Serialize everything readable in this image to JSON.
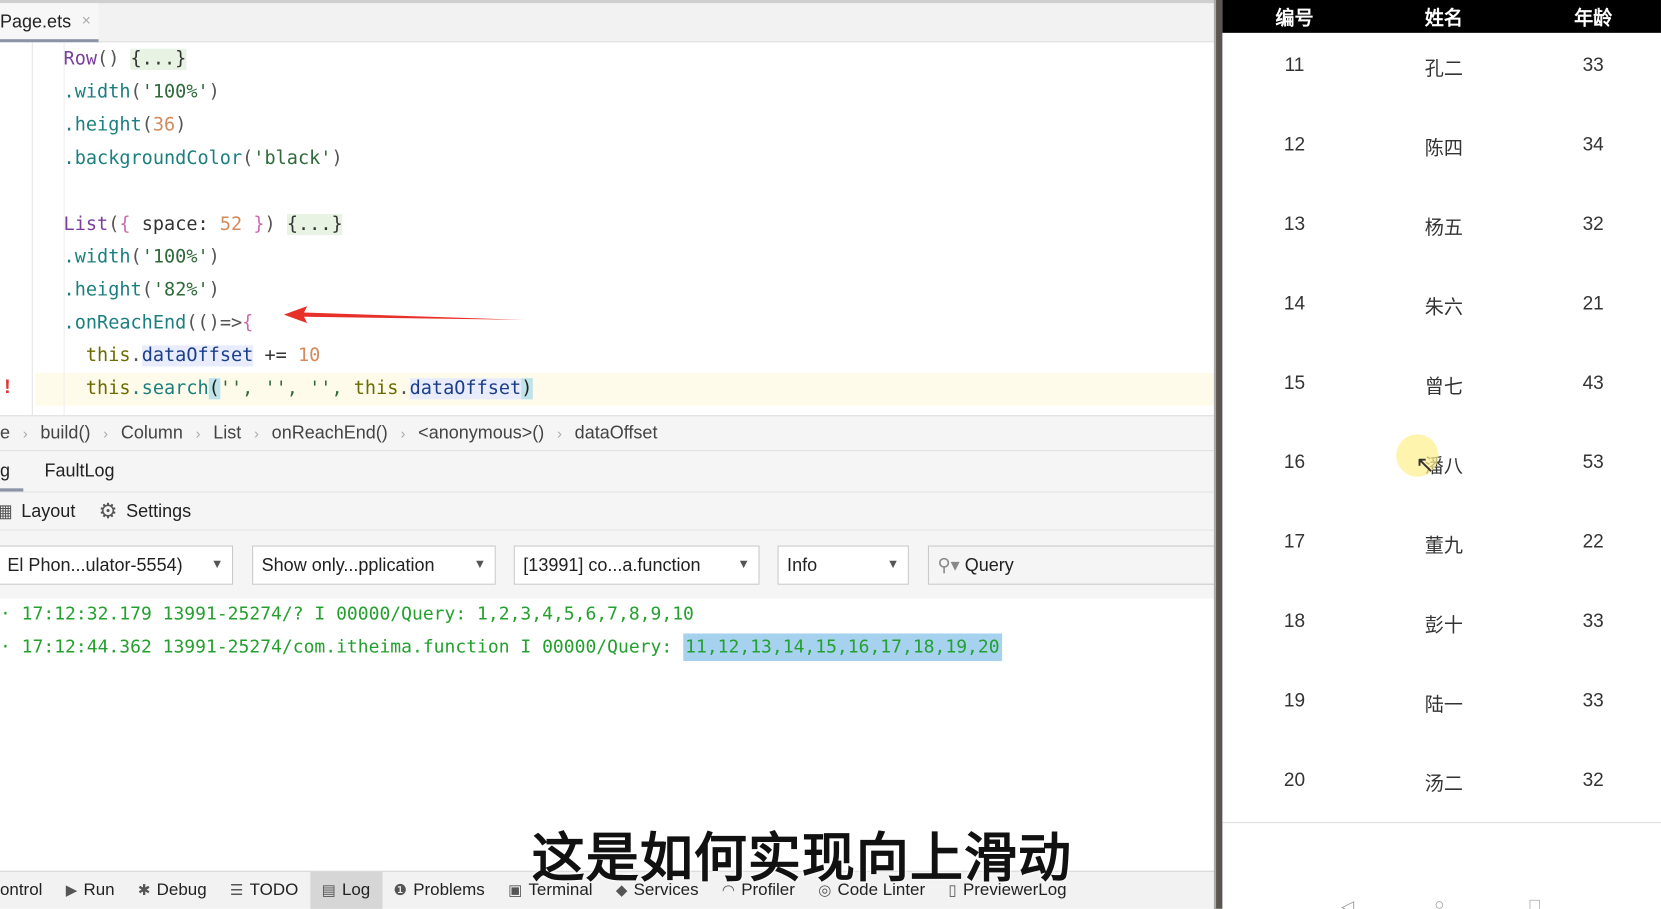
{
  "editor": {
    "tab": {
      "name": "Page.ets",
      "close": "×"
    },
    "code": [
      [
        [
          "Row",
          "k-fn"
        ],
        [
          "() ",
          "k-p"
        ],
        [
          "{...}",
          "k-fold"
        ]
      ],
      [
        [
          ".width",
          "k-m"
        ],
        [
          "(",
          "k-p"
        ],
        [
          "'100%'",
          "k-s"
        ],
        [
          ")",
          "k-p"
        ]
      ],
      [
        [
          ".height",
          "k-m"
        ],
        [
          "(",
          "k-p"
        ],
        [
          "36",
          "k-n"
        ],
        [
          ")",
          "k-p"
        ]
      ],
      [
        [
          ".backgroundColor",
          "k-m"
        ],
        [
          "(",
          "k-p"
        ],
        [
          "'black'",
          "k-s"
        ],
        [
          ")",
          "k-p"
        ]
      ],
      [],
      [
        [
          "List",
          "k-fn"
        ],
        [
          "(",
          "k-p"
        ],
        [
          "{",
          "k-pk"
        ],
        [
          " space: ",
          "k-txt"
        ],
        [
          "52",
          "k-n"
        ],
        [
          " }",
          "k-pk"
        ],
        [
          ") ",
          "k-p"
        ],
        [
          "{...}",
          "k-fold"
        ]
      ],
      [
        [
          ".width",
          "k-m"
        ],
        [
          "(",
          "k-p"
        ],
        [
          "'100%'",
          "k-s"
        ],
        [
          ")",
          "k-p"
        ]
      ],
      [
        [
          ".height",
          "k-m"
        ],
        [
          "(",
          "k-p"
        ],
        [
          "'82%'",
          "k-s"
        ],
        [
          ")",
          "k-p"
        ]
      ],
      [
        [
          ".onReachEnd",
          "k-m"
        ],
        [
          "(()=>",
          "k-p"
        ],
        [
          "{",
          "k-pk"
        ]
      ],
      [
        [
          "  this",
          "k-this"
        ],
        [
          ".",
          "k-p"
        ],
        [
          "dataOffset",
          "k-f"
        ],
        [
          " += ",
          "k-txt"
        ],
        [
          "10",
          "k-n"
        ]
      ],
      [
        [
          "  this",
          "k-this"
        ],
        [
          ".search",
          "k-m"
        ],
        [
          "(",
          "k-br"
        ],
        [
          "'', '', '', ",
          "k-s"
        ],
        [
          "this",
          "k-this"
        ],
        [
          ".",
          "k-p"
        ],
        [
          "dataOffset",
          "k-f"
        ],
        [
          ")",
          "k-br"
        ]
      ]
    ],
    "breadcrumb": [
      "e",
      "build()",
      "Column",
      "List",
      "onReachEnd()",
      "<anonymous>()",
      "dataOffset"
    ]
  },
  "log": {
    "tabs": [
      "g",
      "FaultLog"
    ],
    "tools": {
      "layout": "Layout",
      "settings": "Settings"
    },
    "filters": {
      "device": "El Phon...ulator-5554)",
      "scope": "Show only...pplication",
      "process": "[13991] co...a.function",
      "level": "Info",
      "query_placeholder": "Query"
    },
    "lines": [
      {
        "prefix": "· 17:12:32.179 13991-25274/? I 00000/Query: ",
        "data": "1,2,3,4,5,6,7,8,9,10"
      },
      {
        "prefix": "· 17:12:44.362 13991-25274/com.itheima.function I 00000/Query: ",
        "data": "11,12,13,14,15,16,17,18,19,20"
      }
    ]
  },
  "bottom_tools": [
    {
      "label": "ontrol",
      "icon": ""
    },
    {
      "label": "Run",
      "icon": "▶"
    },
    {
      "label": "Debug",
      "icon": "✱"
    },
    {
      "label": "TODO",
      "icon": "☰"
    },
    {
      "label": "Log",
      "icon": "▤"
    },
    {
      "label": "Problems",
      "icon": "❶"
    },
    {
      "label": "Terminal",
      "icon": "▣"
    },
    {
      "label": "Services",
      "icon": "◆"
    },
    {
      "label": "Profiler",
      "icon": "◠"
    },
    {
      "label": "Code Linter",
      "icon": "◎"
    },
    {
      "label": "PreviewerLog",
      "icon": "▯"
    }
  ],
  "subtitle": "这是如何实现向上滑动",
  "phone": {
    "headers": [
      "编号",
      "姓名",
      "年龄"
    ],
    "rows": [
      [
        "11",
        "孔二",
        "33"
      ],
      [
        "12",
        "陈四",
        "34"
      ],
      [
        "13",
        "杨五",
        "32"
      ],
      [
        "14",
        "朱六",
        "21"
      ],
      [
        "15",
        "曾七",
        "43"
      ],
      [
        "16",
        "潘八",
        "53"
      ],
      [
        "17",
        "董九",
        "22"
      ],
      [
        "18",
        "彭十",
        "33"
      ],
      [
        "19",
        "陆一",
        "33"
      ],
      [
        "20",
        "汤二",
        "32"
      ]
    ]
  },
  "colors": {
    "log_text": "#23a02d",
    "annotation_arrow": "#e8302a",
    "selection": "#a6d2f0"
  }
}
